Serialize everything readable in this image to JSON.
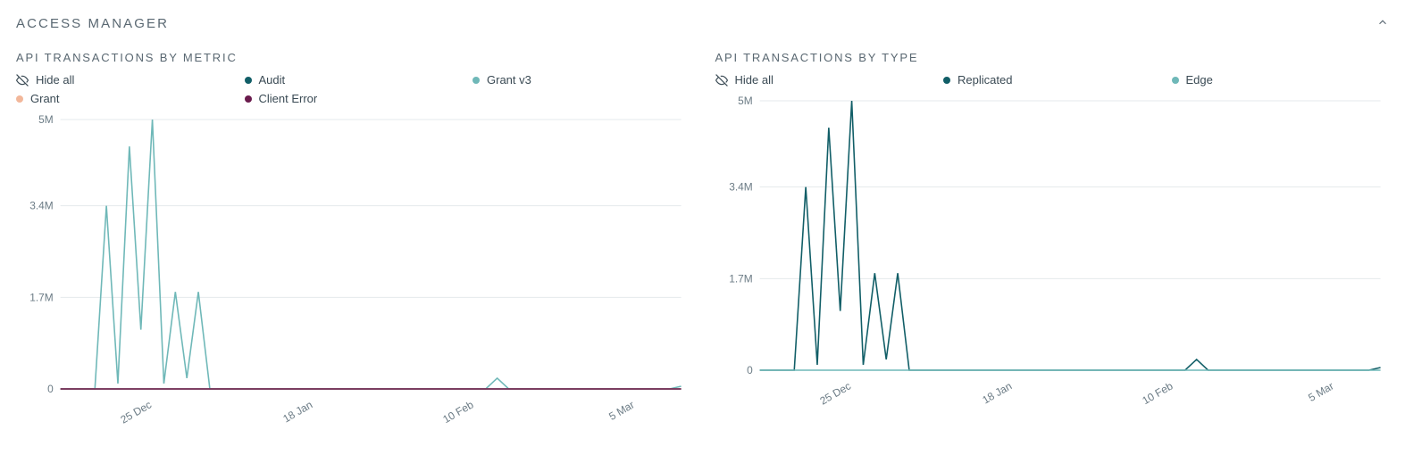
{
  "panel_title": "ACCESS MANAGER",
  "charts": [
    {
      "id": "metric",
      "title": "API TRANSACTIONS BY METRIC",
      "hide_all_label": "Hide all",
      "legend": [
        {
          "name": "Audit",
          "color": "#115e67",
          "series_key": "audit"
        },
        {
          "name": "Grant v3",
          "color": "#6fb8b8",
          "series_key": "grant_v3"
        },
        {
          "name": "Grant",
          "color": "#f2b79a",
          "series_key": "grant"
        },
        {
          "name": "Client Error",
          "color": "#6a1b4d",
          "series_key": "client_error"
        }
      ]
    },
    {
      "id": "type",
      "title": "API TRANSACTIONS BY TYPE",
      "hide_all_label": "Hide all",
      "legend": [
        {
          "name": "Replicated",
          "color": "#115e67",
          "series_key": "replicated"
        },
        {
          "name": "Edge",
          "color": "#6fb8b8",
          "series_key": "edge"
        }
      ]
    }
  ],
  "chart_data": [
    {
      "id": "metric",
      "type": "line",
      "title": "API TRANSACTIONS BY METRIC",
      "xlabel": "",
      "ylabel": "",
      "ylim": [
        0,
        5000000
      ],
      "y_ticks": [
        0,
        1700000,
        3400000,
        5000000
      ],
      "y_tick_labels": [
        "0",
        "1.7M",
        "3.4M",
        "5M"
      ],
      "x_tick_labels": [
        "25 Dec",
        "18 Jan",
        "10 Feb",
        "5 Mar"
      ],
      "x_tick_indices": [
        8,
        22,
        36,
        50
      ],
      "x_count": 55,
      "series": [
        {
          "name": "Grant v3",
          "color": "#6fb8b8",
          "values": [
            0,
            0,
            0,
            0,
            3400000,
            100000,
            4500000,
            1100000,
            5000000,
            100000,
            1800000,
            200000,
            1800000,
            0,
            0,
            0,
            0,
            0,
            0,
            0,
            0,
            0,
            0,
            0,
            0,
            0,
            0,
            0,
            0,
            0,
            0,
            0,
            0,
            0,
            0,
            0,
            0,
            0,
            200000,
            0,
            0,
            0,
            0,
            0,
            0,
            0,
            0,
            0,
            0,
            0,
            0,
            0,
            0,
            0,
            50000
          ]
        },
        {
          "name": "Audit",
          "color": "#115e67",
          "values": [
            0,
            0,
            0,
            0,
            0,
            0,
            0,
            0,
            0,
            0,
            0,
            0,
            0,
            0,
            0,
            0,
            0,
            0,
            0,
            0,
            0,
            0,
            0,
            0,
            0,
            0,
            0,
            0,
            0,
            0,
            0,
            0,
            0,
            0,
            0,
            0,
            0,
            0,
            0,
            0,
            0,
            0,
            0,
            0,
            0,
            0,
            0,
            0,
            0,
            0,
            0,
            0,
            0,
            0,
            0
          ]
        },
        {
          "name": "Grant",
          "color": "#f2b79a",
          "values": [
            0,
            0,
            0,
            0,
            0,
            0,
            0,
            0,
            0,
            0,
            0,
            0,
            0,
            0,
            0,
            0,
            0,
            0,
            0,
            0,
            0,
            0,
            0,
            0,
            0,
            0,
            0,
            0,
            0,
            0,
            0,
            0,
            0,
            0,
            0,
            0,
            0,
            0,
            0,
            0,
            0,
            0,
            0,
            0,
            0,
            0,
            0,
            0,
            0,
            0,
            0,
            0,
            0,
            0,
            0
          ]
        },
        {
          "name": "Client Error",
          "color": "#6a1b4d",
          "values": [
            0,
            0,
            0,
            0,
            0,
            0,
            0,
            0,
            0,
            0,
            0,
            0,
            0,
            0,
            0,
            0,
            0,
            0,
            0,
            0,
            0,
            0,
            0,
            0,
            0,
            0,
            0,
            0,
            0,
            0,
            0,
            0,
            0,
            0,
            0,
            0,
            0,
            0,
            0,
            0,
            0,
            0,
            0,
            0,
            0,
            0,
            0,
            0,
            0,
            0,
            0,
            0,
            0,
            0,
            0
          ]
        }
      ]
    },
    {
      "id": "type",
      "type": "line",
      "title": "API TRANSACTIONS BY TYPE",
      "xlabel": "",
      "ylabel": "",
      "ylim": [
        0,
        5000000
      ],
      "y_ticks": [
        0,
        1700000,
        3400000,
        5000000
      ],
      "y_tick_labels": [
        "0",
        "1.7M",
        "3.4M",
        "5M"
      ],
      "x_tick_labels": [
        "25 Dec",
        "18 Jan",
        "10 Feb",
        "5 Mar"
      ],
      "x_tick_indices": [
        8,
        22,
        36,
        50
      ],
      "x_count": 55,
      "series": [
        {
          "name": "Replicated",
          "color": "#115e67",
          "values": [
            0,
            0,
            0,
            0,
            3400000,
            100000,
            4500000,
            1100000,
            5000000,
            100000,
            1800000,
            200000,
            1800000,
            0,
            0,
            0,
            0,
            0,
            0,
            0,
            0,
            0,
            0,
            0,
            0,
            0,
            0,
            0,
            0,
            0,
            0,
            0,
            0,
            0,
            0,
            0,
            0,
            0,
            200000,
            0,
            0,
            0,
            0,
            0,
            0,
            0,
            0,
            0,
            0,
            0,
            0,
            0,
            0,
            0,
            50000
          ]
        },
        {
          "name": "Edge",
          "color": "#6fb8b8",
          "values": [
            0,
            0,
            0,
            0,
            0,
            0,
            0,
            0,
            0,
            0,
            0,
            0,
            0,
            0,
            0,
            0,
            0,
            0,
            0,
            0,
            0,
            0,
            0,
            0,
            0,
            0,
            0,
            0,
            0,
            0,
            0,
            0,
            0,
            0,
            0,
            0,
            0,
            0,
            0,
            0,
            0,
            0,
            0,
            0,
            0,
            0,
            0,
            0,
            0,
            0,
            0,
            0,
            0,
            0,
            0
          ]
        }
      ]
    }
  ]
}
